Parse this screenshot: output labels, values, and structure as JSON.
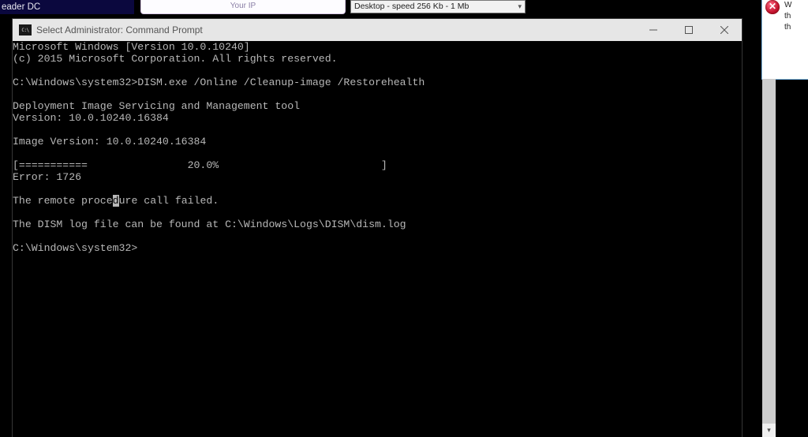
{
  "background": {
    "taskbar_fragment": "eader DC",
    "card_label": "Your IP",
    "dropdown_label": "Desktop - speed  256 Kb - 1 Mb",
    "popup_line1": "W",
    "popup_line2": "th",
    "popup_line3": "th",
    "popup_icon_char": "✕"
  },
  "window": {
    "title": "Select Administrator: Command Prompt",
    "minimize_tip": "Minimize",
    "maximize_tip": "Maximize",
    "close_tip": "Close"
  },
  "console": {
    "lines": [
      "Microsoft Windows [Version 10.0.10240]",
      "(c) 2015 Microsoft Corporation. All rights reserved.",
      "",
      "C:\\Windows\\system32>DISM.exe /Online /Cleanup-image /Restorehealth",
      "",
      "Deployment Image Servicing and Management tool",
      "Version: 10.0.10240.16384",
      "",
      "Image Version: 10.0.10240.16384",
      "",
      "[===========                20.0%                          ] ",
      "Error: 1726",
      "",
      "",
      "",
      "The DISM log file can be found at C:\\Windows\\Logs\\DISM\\dism.log",
      "",
      "C:\\Windows\\system32>"
    ],
    "cursor_line": {
      "pre": "The remote proce",
      "cursor_char": "d",
      "post": "ure call failed."
    },
    "cursor_line_index": 13
  }
}
